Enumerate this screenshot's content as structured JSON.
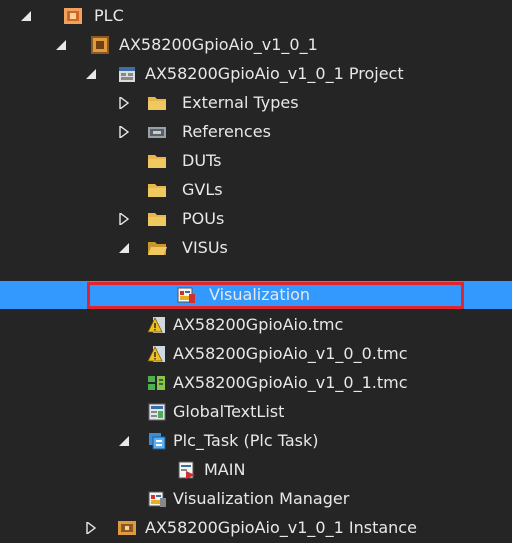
{
  "tree": {
    "plc": "PLC",
    "plc_project": "AX58200GpioAio_v1_0_1",
    "project": "AX58200GpioAio_v1_0_1 Project",
    "external_types": "External Types",
    "references": "References",
    "duts": "DUTs",
    "gvls": "GVLs",
    "pous": "POUs",
    "visus": "VISUs",
    "visualization": "Visualization",
    "tmc1": "AX58200GpioAio.tmc",
    "tmc2": "AX58200GpioAio_v1_0_0.tmc",
    "tmc3": "AX58200GpioAio_v1_0_1.tmc",
    "global_text_list": "GlobalTextList",
    "plc_task": "Plc_Task (Plc Task)",
    "main": "MAIN",
    "vis_manager": "Visualization Manager",
    "instance": "AX58200GpioAio_v1_0_1 Instance"
  },
  "colors": {
    "background": "#252526",
    "selection": "#3399ff",
    "highlight_border": "#e0252d",
    "folder": "#e8b64a"
  }
}
